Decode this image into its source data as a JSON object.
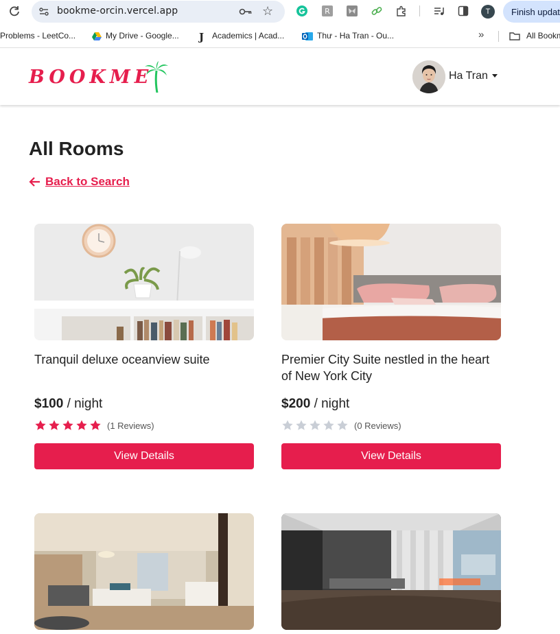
{
  "browser": {
    "url": "bookme-orcin.vercel.app",
    "profile_initial": "T",
    "finish_update_label": "Finish update",
    "bookmarks": [
      {
        "label": "Problems - LeetCo..."
      },
      {
        "label": "My Drive - Google..."
      },
      {
        "label": "Academics | Acad..."
      },
      {
        "label": "Thư - Ha Tran - Ou..."
      },
      {
        "label": "All Bookmarks"
      }
    ]
  },
  "header": {
    "logo_text": "BOOKME",
    "user_name": "Ha Tran"
  },
  "page": {
    "title": "All Rooms",
    "back_link": "Back to Search"
  },
  "rooms": [
    {
      "name": "Tranquil deluxe oceanview suite",
      "price": "$100",
      "per": "/ night",
      "rating": 5,
      "reviews": "(1 Reviews)",
      "button": "View Details"
    },
    {
      "name": "Premier City Suite nestled in the heart of New York City",
      "price": "$200",
      "per": "/ night",
      "rating": 0,
      "reviews": "(0 Reviews)",
      "button": "View Details"
    },
    {
      "name": "",
      "price": "",
      "per": "",
      "rating": 0,
      "reviews": "",
      "button": ""
    },
    {
      "name": "",
      "price": "",
      "per": "",
      "rating": 0,
      "reviews": "",
      "button": ""
    }
  ],
  "colors": {
    "accent": "#e61e4d",
    "star_filled": "#e61e4d",
    "star_empty": "#c9ced6",
    "palm": "#22c55e"
  }
}
